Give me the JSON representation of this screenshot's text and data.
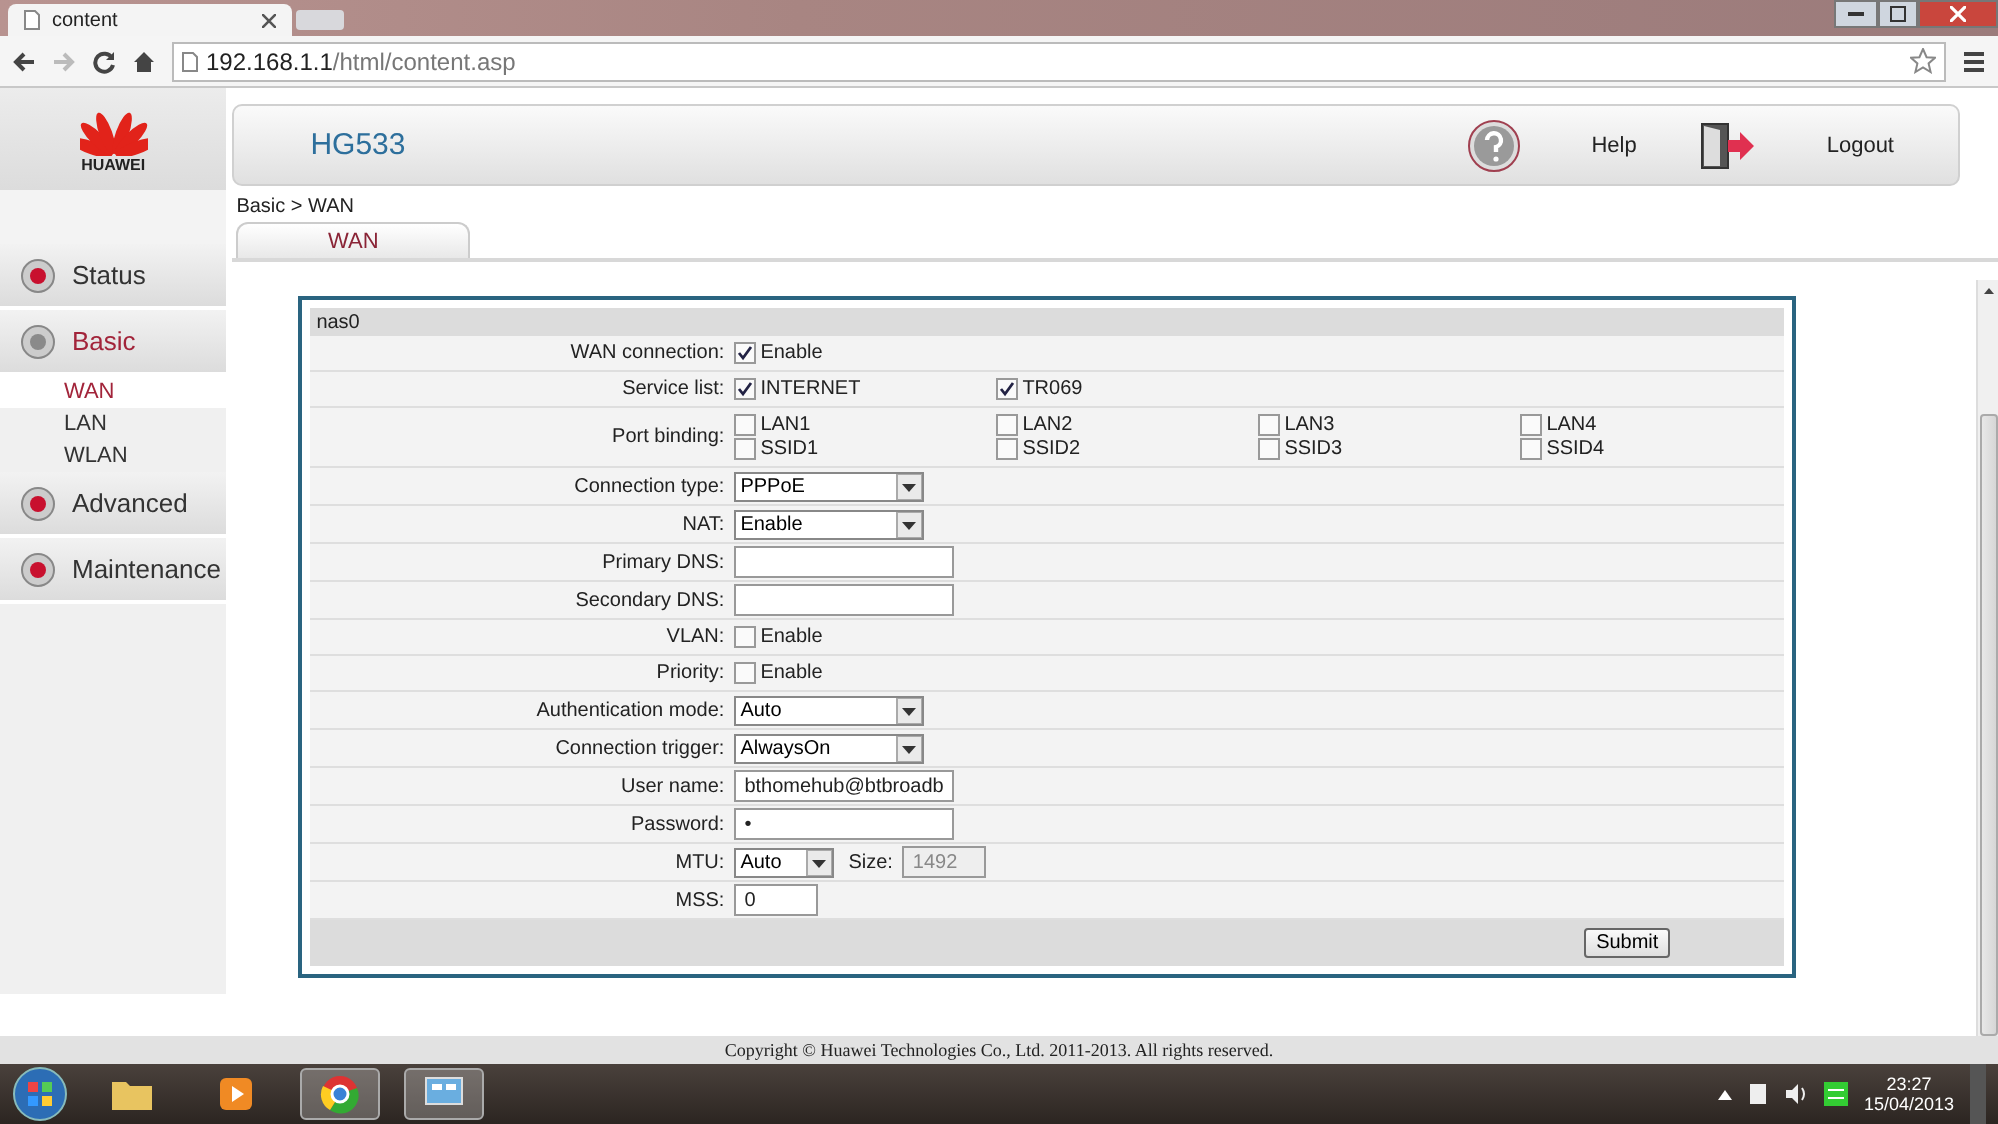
{
  "browser": {
    "tab_title": "content",
    "url_host": "192.168.1.1",
    "url_path": "/html/content.asp"
  },
  "header": {
    "logo_text": "HUAWEI",
    "product": "HG533",
    "help": "Help",
    "logout": "Logout"
  },
  "sidebar": {
    "items": [
      {
        "label": "Status",
        "selected": false
      },
      {
        "label": "Basic",
        "selected": true,
        "children": [
          {
            "label": "WAN",
            "selected": true
          },
          {
            "label": "LAN",
            "selected": false
          },
          {
            "label": "WLAN",
            "selected": false
          }
        ]
      },
      {
        "label": "Advanced",
        "selected": false
      },
      {
        "label": "Maintenance",
        "selected": false
      }
    ]
  },
  "breadcrumb": "Basic > WAN",
  "tabs": [
    {
      "label": "WAN",
      "selected": true
    }
  ],
  "form": {
    "title": "nas0",
    "rows": [
      {
        "kind": "checks",
        "label": "WAN connection:",
        "options": [
          {
            "label": "Enable",
            "checked": true
          }
        ]
      },
      {
        "kind": "checks",
        "label": "Service list:",
        "options": [
          {
            "label": "INTERNET",
            "checked": true
          },
          {
            "label": "TR069",
            "checked": true
          }
        ]
      },
      {
        "kind": "checks",
        "label": "Port binding:",
        "options": [
          {
            "label": "LAN1",
            "checked": false
          },
          {
            "label": "LAN2",
            "checked": false
          },
          {
            "label": "LAN3",
            "checked": false
          },
          {
            "label": "LAN4",
            "checked": false
          },
          {
            "label": "SSID1",
            "checked": false
          },
          {
            "label": "SSID2",
            "checked": false
          },
          {
            "label": "SSID3",
            "checked": false
          },
          {
            "label": "SSID4",
            "checked": false
          }
        ]
      },
      {
        "kind": "select",
        "label": "Connection type:",
        "value": "PPPoE"
      },
      {
        "kind": "select",
        "label": "NAT:",
        "value": "Enable"
      },
      {
        "kind": "text",
        "label": "Primary DNS:"
      },
      {
        "kind": "text",
        "label": "Secondary DNS:"
      },
      {
        "kind": "checks",
        "label": "VLAN:",
        "options": [
          {
            "label": "Enable",
            "checked": false
          }
        ]
      },
      {
        "kind": "checks",
        "label": "Priority:",
        "options": [
          {
            "label": "Enable",
            "checked": false
          }
        ]
      },
      {
        "kind": "select",
        "label": "Authentication mode:",
        "value": "Auto"
      },
      {
        "kind": "select",
        "label": "Connection trigger:",
        "value": "AlwaysOn"
      },
      {
        "kind": "text",
        "label": "User name:",
        "value": "bthomehub@btbroadb"
      },
      {
        "kind": "text",
        "label": "Password:",
        "value": "•"
      },
      {
        "kind": "mtu",
        "label": "MTU:",
        "value": "Auto",
        "size_label": "Size:",
        "size_value": "1492",
        "size_disabled": true
      },
      {
        "kind": "short",
        "label": "MSS:",
        "value": "0"
      }
    ],
    "submit": "Submit"
  },
  "footer": "Copyright © Huawei Technologies Co., Ltd. 2011-2013. All rights reserved.",
  "taskbar": {
    "time": "23:27",
    "date": "15/04/2013"
  }
}
